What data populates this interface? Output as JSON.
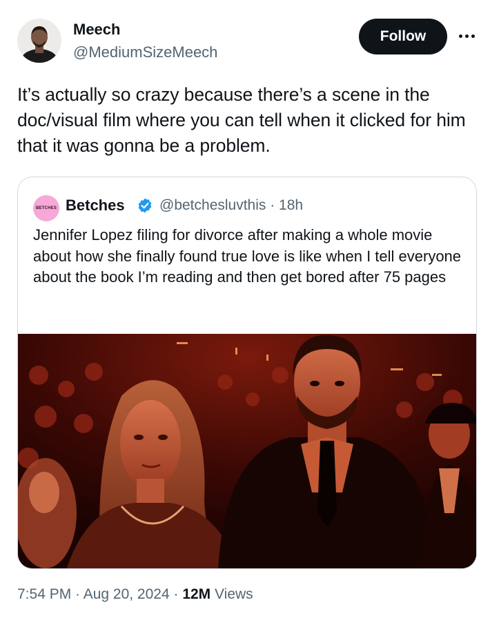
{
  "author": {
    "name": "Meech",
    "handle": "@MediumSizeMeech"
  },
  "follow_label": "Follow",
  "more_icon": "more-horizontal-icon",
  "text": "It’s actually so crazy because there’s a scene in the doc/visual film where you can tell when it clicked for him that it was gonna be a problem.",
  "quoted": {
    "avatar_text": "BETCHES",
    "name": "Betches",
    "verified_icon": "verified-badge-icon",
    "handle_time": "@betchesluvthis · 18h",
    "text": "Jennifer Lopez filing for divorce after making a whole movie about how she finally found true love is like when I tell everyone about the book I’m reading and then get bored after 75 pages",
    "media": "photo of a couple standing in an audience under red lighting"
  },
  "meta": {
    "time_date": "7:54 PM · Aug 20, 2024 · ",
    "views_count": "12M",
    "views_label": " Views"
  },
  "colors": {
    "text": "#0f1419",
    "secondary": "#536471",
    "verified": "#1d9bf0",
    "follow_bg": "#0f1419",
    "border": "#cfd9de"
  }
}
